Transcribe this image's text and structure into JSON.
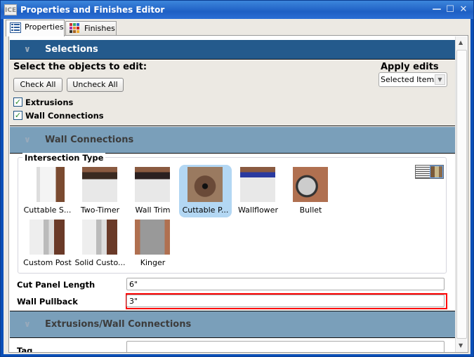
{
  "window": {
    "title": "Properties and Finishes Editor",
    "app_icon": "ICE"
  },
  "tabs": [
    {
      "label": "Properties",
      "icon": "list-icon",
      "active": true
    },
    {
      "label": "Finishes",
      "icon": "color-grid-icon",
      "active": false
    }
  ],
  "selections": {
    "header": "Selections",
    "prompt": "Select the objects to edit:",
    "check_all": "Check All",
    "uncheck_all": "Uncheck All",
    "apply_label": "Apply edits to:",
    "apply_value": "Selected Items",
    "checkboxes": [
      {
        "label": "Extrusions",
        "checked": true
      },
      {
        "label": "Wall Connections",
        "checked": true
      }
    ]
  },
  "wall_connections": {
    "header": "Wall Connections",
    "group_label": "Intersection Type",
    "items": [
      {
        "label": "Cuttable S...",
        "selected": false
      },
      {
        "label": "Two-Timer",
        "selected": false
      },
      {
        "label": "Wall Trim",
        "selected": false
      },
      {
        "label": "Cuttable P...",
        "selected": true
      },
      {
        "label": "Wallflower",
        "selected": false
      },
      {
        "label": "Bullet",
        "selected": false
      },
      {
        "label": "Custom Post",
        "selected": false
      },
      {
        "label": "Solid Custo...",
        "selected": false
      },
      {
        "label": "Kinger",
        "selected": false
      }
    ],
    "fields": [
      {
        "label": "Cut Panel Length",
        "value": "6\""
      },
      {
        "label": "Wall Pullback",
        "value": "3\"",
        "highlighted": true
      }
    ]
  },
  "extrusions_wall": {
    "header": "Extrusions/Wall Connections",
    "fields": [
      {
        "label": "Tag",
        "value": ""
      }
    ]
  },
  "colors": {
    "header_dark": "#245a8c",
    "header_light": "#7a9fba",
    "highlight": "#ff0000",
    "selected": "#b3d7f3"
  }
}
